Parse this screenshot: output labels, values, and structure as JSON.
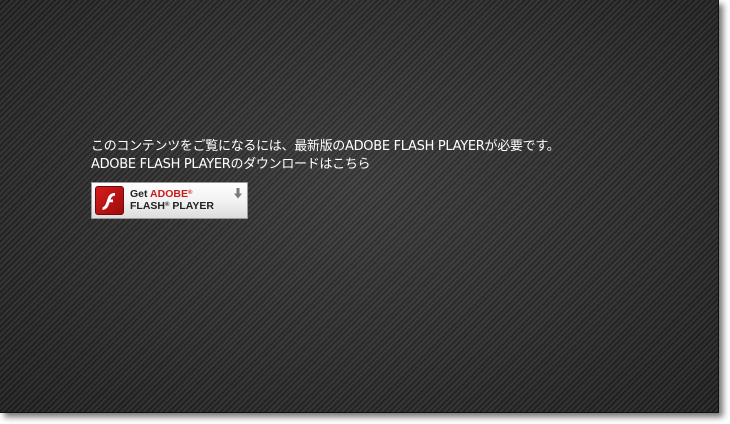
{
  "message": {
    "line1": "このコンテンツをご覧になるには、最新版のADOBE FLASH PLAYERが必要です。",
    "line2": "ADOBE FLASH PLAYERのダウンロードはこちら"
  },
  "badge": {
    "get_label": "Get",
    "brand_label": "ADOBE",
    "product_label": "FLASH",
    "product_suffix": "PLAYER",
    "registered_mark": "®",
    "icon": "flash-player-logo",
    "download_icon": "download-arrow-icon"
  },
  "colors": {
    "background": "#2e2e2e",
    "text": "#ffffff",
    "brand_red": "#cc1a1a"
  }
}
